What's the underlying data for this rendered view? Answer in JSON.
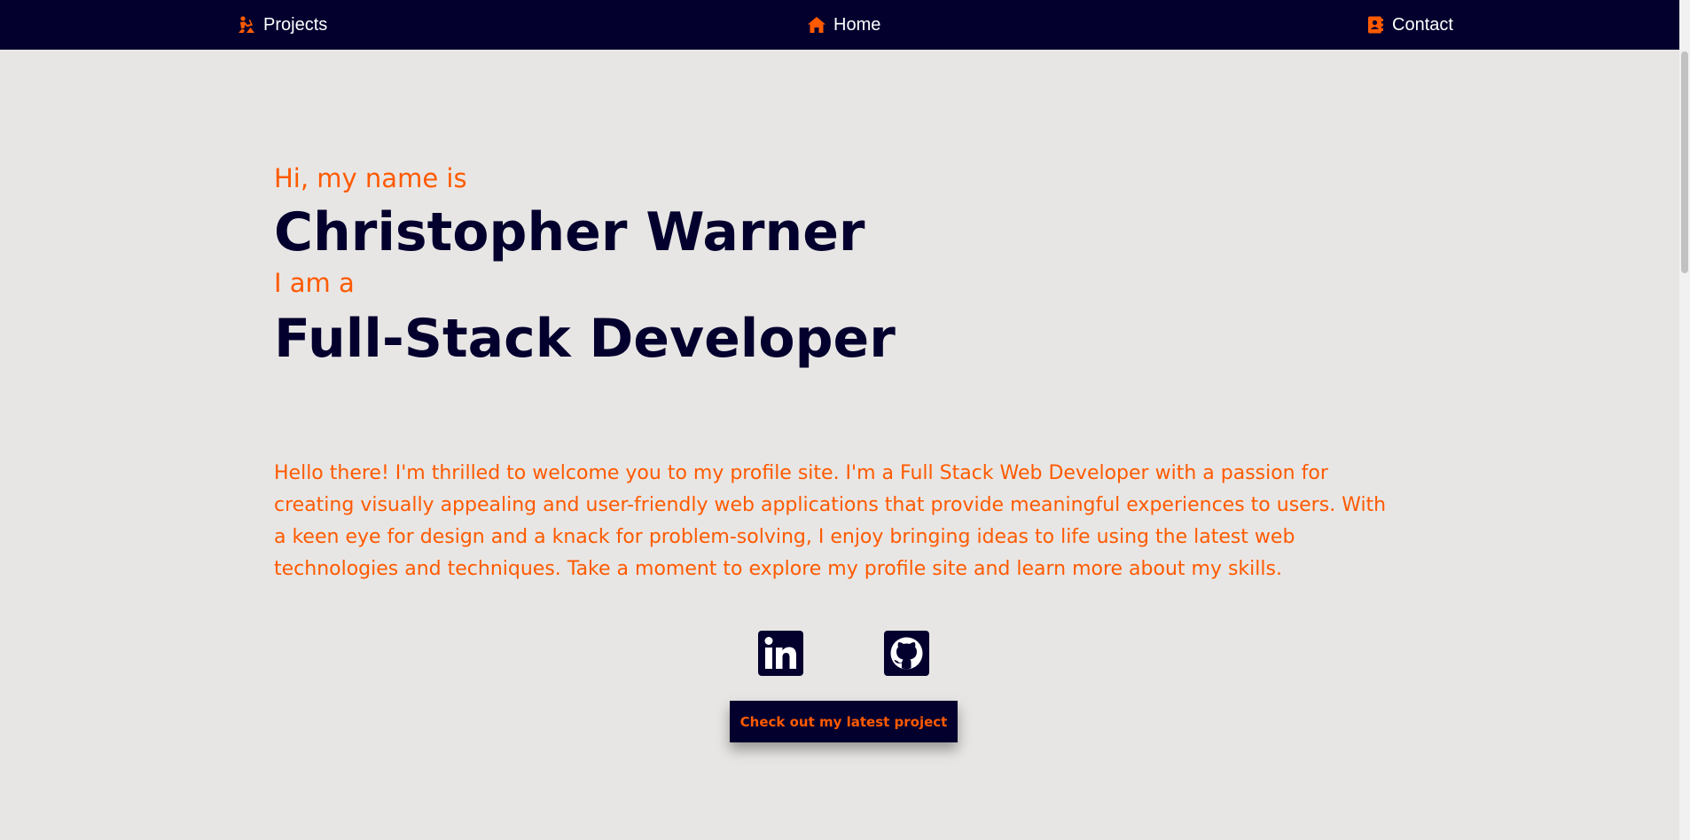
{
  "nav": {
    "projects_label": "Projects",
    "home_label": "Home",
    "contact_label": "Contact",
    "projects_icon": "person-digging-icon",
    "home_icon": "house-icon",
    "contact_icon": "address-book-icon"
  },
  "hero": {
    "greeting": "Hi, my name is",
    "name": "Christopher Warner",
    "intro": "I am a",
    "role": "Full-Stack Developer"
  },
  "bio": "Hello there! I'm thrilled to welcome you to my profile site. I'm a Full Stack Web Developer with a passion for creating visually appealing and user-friendly web applications that provide meaningful experiences to users. With a keen eye for design and a knack for problem-solving, I enjoy bringing ideas to life using the latest web technologies and techniques. Take a moment to explore my profile site and learn more about my skills.",
  "socials": [
    {
      "icon": "linkedin-icon"
    },
    {
      "icon": "github-icon"
    }
  ],
  "cta_label": "Check out my latest project",
  "colors": {
    "navy": "#03002e",
    "accent": "#ff5a00",
    "background": "#e8e6e4"
  }
}
